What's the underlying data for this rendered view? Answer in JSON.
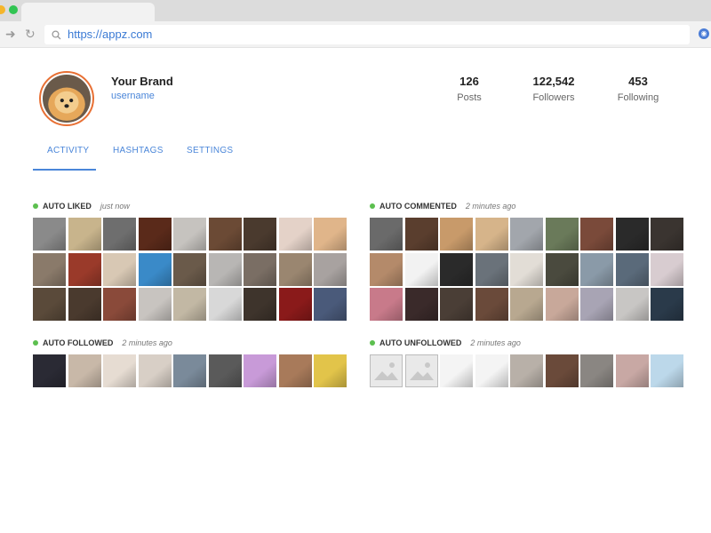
{
  "browser": {
    "url": "https://appz.com"
  },
  "profile": {
    "name": "Your Brand",
    "username": "username"
  },
  "stats": [
    {
      "value": "126",
      "label": "Posts"
    },
    {
      "value": "122,542",
      "label": "Followers"
    },
    {
      "value": "453",
      "label": "Following"
    }
  ],
  "tabs": [
    "ACTIVITY",
    "HASHTAGS",
    "SETTINGS"
  ],
  "sections": {
    "auto_liked": {
      "title": "AUTO LIKED",
      "time": "just now"
    },
    "auto_commented": {
      "title": "AUTO COMMENTED",
      "time": "2 minutes ago"
    },
    "auto_followed": {
      "title": "AUTO FOLLOWED",
      "time": "2 minutes ago"
    },
    "auto_unfollowed": {
      "title": "AUTO UNFOLLOWED",
      "time": "2 minutes ago"
    }
  },
  "colors": {
    "accent": "#4a86d9",
    "status_dot": "#5cbf4f",
    "avatar_ring": "#e87034",
    "auto_liked": [
      "#8a8a8a",
      "#c8b48c",
      "#6e6e6e",
      "#5a2a1a",
      "#c6c3bf",
      "#6b4a35",
      "#4a3a2e",
      "#e4d2c8",
      "#e0b58a",
      "#8a7a6a",
      "#9a3a2a",
      "#d8c8b4",
      "#3a8ac8",
      "#6a5a4a",
      "#b8b6b4",
      "#7a6e64",
      "#9a8670",
      "#a8a2a0",
      "#5a4a3a",
      "#4a3a2e",
      "#8a4a3a",
      "#c8c4c0",
      "#c2b8a4",
      "#d8d8d8",
      "#3e342c",
      "#8a1a1a",
      "#4a5a7a"
    ],
    "auto_commented": [
      "#6a6a6a",
      "#5a3e2e",
      "#c89a6a",
      "#d6b48a",
      "#a2a6ac",
      "#6a7a5a",
      "#7a4a3a",
      "#2a2a2a",
      "#3a3430",
      "#b48a6a",
      "#f2f2f2",
      "#2a2a2a",
      "#6a727a",
      "#e2ddd6",
      "#4a4a3e",
      "#8a9aa8",
      "#5a6a7a",
      "#d8ccd0",
      "#c87a8a",
      "#3a2a2a",
      "#4a3e36",
      "#6a4a3a",
      "#b8a890",
      "#c8a89a",
      "#a8a4b4",
      "#c8c6c4",
      "#2a3a4a"
    ],
    "auto_followed": [
      "#2a2a34",
      "#c8b8a8",
      "#e6dcd2",
      "#d8cfc6",
      "#7a8a9a",
      "#5a5a5a",
      "#c89ad8",
      "#a87a5a",
      "#e2c44a"
    ],
    "auto_unfollowed": [
      "placeholder",
      "placeholder",
      "#f4f4f4",
      "#f4f4f4",
      "#b8b0a8",
      "#6a4a3a",
      "#8a8682",
      "#c8a8a4",
      "#bcd8ea"
    ]
  }
}
